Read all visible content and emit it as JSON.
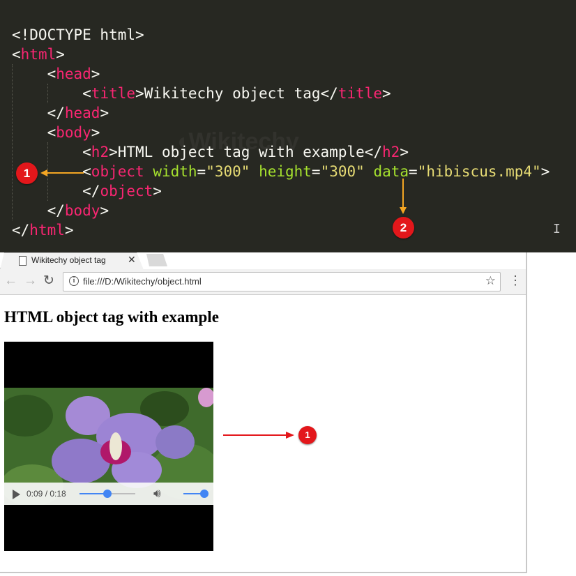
{
  "editor": {
    "lines": [
      {
        "segments": [
          {
            "t": "<!DOCTYPE html>",
            "c": "text"
          }
        ]
      },
      {
        "segments": [
          {
            "t": "<",
            "c": "text"
          },
          {
            "t": "html",
            "c": "tag"
          },
          {
            "t": ">",
            "c": "text"
          }
        ]
      },
      {
        "segments": [
          {
            "t": "    <",
            "c": "text"
          },
          {
            "t": "head",
            "c": "tag"
          },
          {
            "t": ">",
            "c": "text"
          }
        ]
      },
      {
        "segments": [
          {
            "t": "        <",
            "c": "text"
          },
          {
            "t": "title",
            "c": "tag"
          },
          {
            "t": ">Wikitechy object tag</",
            "c": "text"
          },
          {
            "t": "title",
            "c": "tag"
          },
          {
            "t": ">",
            "c": "text"
          }
        ]
      },
      {
        "segments": [
          {
            "t": "    </",
            "c": "text"
          },
          {
            "t": "head",
            "c": "tag"
          },
          {
            "t": ">",
            "c": "text"
          }
        ]
      },
      {
        "segments": [
          {
            "t": "    <",
            "c": "text"
          },
          {
            "t": "body",
            "c": "tag"
          },
          {
            "t": ">",
            "c": "text"
          }
        ]
      },
      {
        "segments": [
          {
            "t": "        <",
            "c": "text"
          },
          {
            "t": "h2",
            "c": "tag"
          },
          {
            "t": ">HTML object tag with example</",
            "c": "text"
          },
          {
            "t": "h2",
            "c": "tag"
          },
          {
            "t": ">",
            "c": "text"
          }
        ]
      },
      {
        "segments": [
          {
            "t": "        <",
            "c": "text"
          },
          {
            "t": "object",
            "c": "tag"
          },
          {
            "t": " ",
            "c": "text"
          },
          {
            "t": "width",
            "c": "attr"
          },
          {
            "t": "=",
            "c": "text"
          },
          {
            "t": "\"300\"",
            "c": "str"
          },
          {
            "t": " ",
            "c": "text"
          },
          {
            "t": "height",
            "c": "attr"
          },
          {
            "t": "=",
            "c": "text"
          },
          {
            "t": "\"300\"",
            "c": "str"
          },
          {
            "t": " ",
            "c": "text"
          },
          {
            "t": "data",
            "c": "attr"
          },
          {
            "t": "=",
            "c": "text"
          },
          {
            "t": "\"hibiscus.mp4\"",
            "c": "str"
          },
          {
            "t": ">",
            "c": "text"
          }
        ]
      },
      {
        "segments": [
          {
            "t": "        </",
            "c": "text"
          },
          {
            "t": "object",
            "c": "tag"
          },
          {
            "t": ">",
            "c": "text"
          }
        ]
      },
      {
        "segments": [
          {
            "t": "    </",
            "c": "text"
          },
          {
            "t": "body",
            "c": "tag"
          },
          {
            "t": ">",
            "c": "text"
          }
        ]
      },
      {
        "segments": [
          {
            "t": "</",
            "c": "text"
          },
          {
            "t": "html",
            "c": "tag"
          },
          {
            "t": ">",
            "c": "text"
          }
        ]
      }
    ]
  },
  "annotations": {
    "badge_object_code": "1",
    "badge_data_attr": "2",
    "badge_video": "1"
  },
  "browser": {
    "tab_title": "Wikitechy object tag",
    "tab_close": "✕",
    "url": "file:///D:/Wikitechy/object.html",
    "page_heading": "HTML object tag with example",
    "video": {
      "time": "0:09 / 0:18",
      "progress_fraction": 0.5,
      "volume_fraction": 1.0
    }
  },
  "colors": {
    "editor_bg": "#272822",
    "tag": "#f92672",
    "attr": "#a6e22e",
    "string": "#e6db74",
    "arrow": "#f5a623",
    "arrow_red": "#e3171b",
    "badge": "#e3171b",
    "media_accent": "#4285f4"
  }
}
